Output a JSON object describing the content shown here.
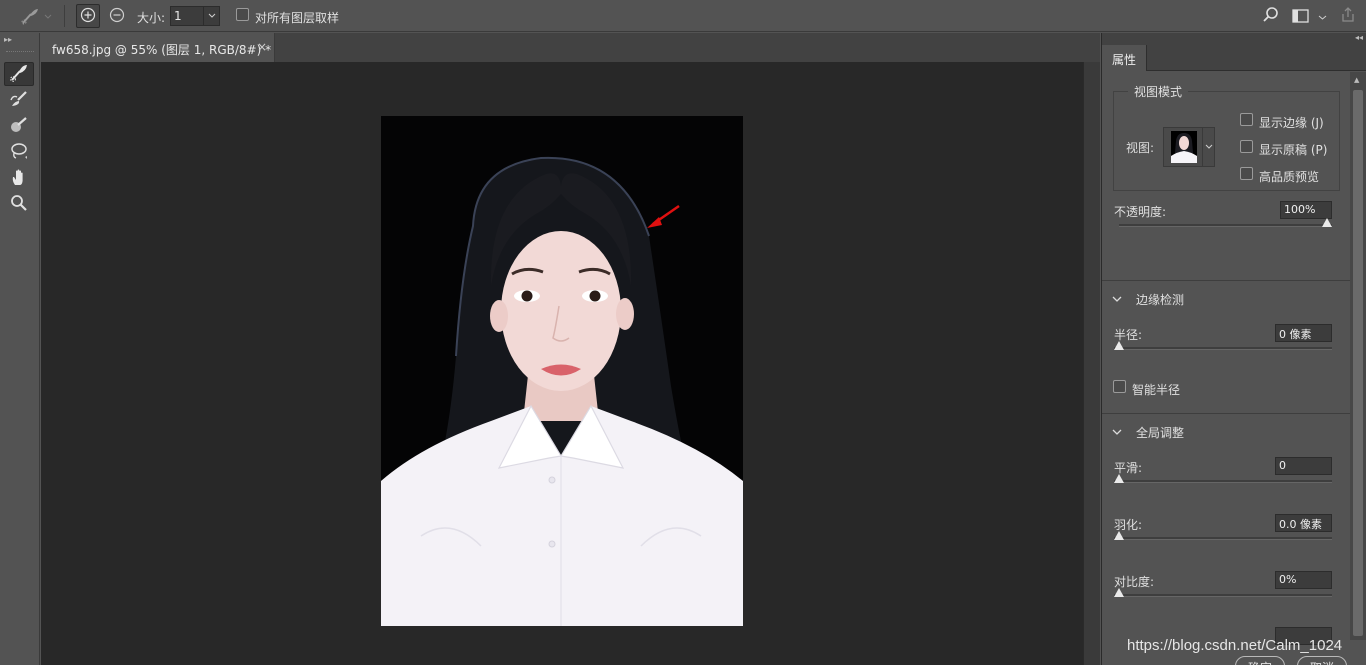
{
  "options_bar": {
    "size_label": "大小:",
    "size_value": "1",
    "sample_all_layers_label": "对所有图层取样",
    "sample_all_layers_checked": false
  },
  "document": {
    "tab_title": "fw658.jpg @ 55% (图层 1, RGB/8#) *",
    "tab_close": "×"
  },
  "properties": {
    "tab_label": "属性",
    "view_mode": {
      "title": "视图模式",
      "view_label": "视图:",
      "show_edges_label": "显示边缘 (J)",
      "show_original_label": "显示原稿 (P)",
      "high_quality_label": "高品质预览"
    },
    "opacity": {
      "label": "不透明度:",
      "value": "100%",
      "level": 1.0
    },
    "edge_detection": {
      "title": "边缘检测",
      "radius_label": "半径:",
      "radius_value": "0 像素",
      "radius_level": 0.0,
      "smart_radius_label": "智能半径"
    },
    "global_refine": {
      "title": "全局调整",
      "smooth_label": "平滑:",
      "smooth_value": "0",
      "smooth_level": 0.0,
      "feather_label": "羽化:",
      "feather_value": "0.0 像素",
      "feather_level": 0.0,
      "contrast_label": "对比度:",
      "contrast_value": "0%",
      "contrast_level": 0.0
    },
    "ok_label": "确定",
    "cancel_label": "取消"
  },
  "watermark": "https://blog.csdn.net/Calm_1024",
  "colors": {
    "ui_bg": "#535353",
    "canvas_bg": "#282828",
    "photo_bg": "#000000",
    "annotation_arrow": "#e01010"
  },
  "icons": {
    "tool_preset": "quick-selection-brush-icon",
    "add": "add-to-selection-icon",
    "subtract": "subtract-from-selection-icon",
    "search": "search-icon",
    "workspace": "workspace-icon",
    "share": "share-icon",
    "tools": [
      "quick-selection-icon",
      "refine-edge-brush-icon",
      "brush-icon",
      "lasso-icon",
      "hand-icon",
      "zoom-icon"
    ]
  }
}
